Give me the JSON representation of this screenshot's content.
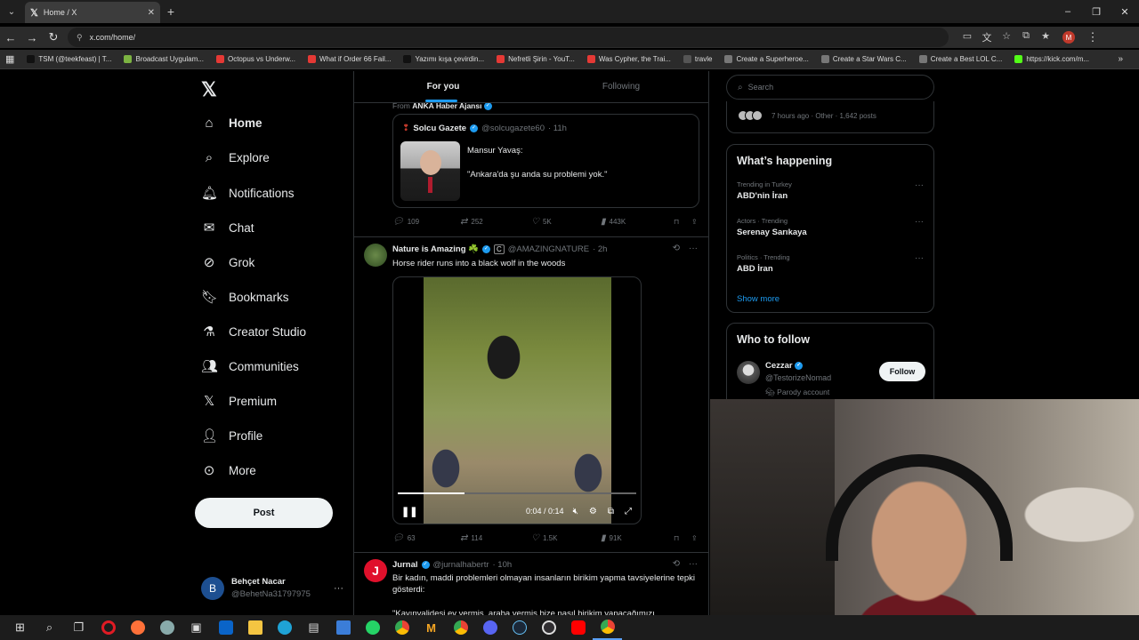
{
  "browser": {
    "tab_title": "Home / X",
    "url": "x.com/home/",
    "profile_initial": "M",
    "bookmarks": [
      {
        "label": "TSM (@teekfeast) | T...",
        "color": "#111111"
      },
      {
        "label": "Broadcast Uygulam...",
        "color": "#7cb342"
      },
      {
        "label": "Octopus vs Underw...",
        "color": "#e53935"
      },
      {
        "label": "What if Order 66 Fail...",
        "color": "#e53935"
      },
      {
        "label": "Yazımı kışa çevirdin...",
        "color": "#111111"
      },
      {
        "label": "Nefretli Şirin - YouT...",
        "color": "#e53935"
      },
      {
        "label": "Was Cypher, the Trai...",
        "color": "#e53935"
      },
      {
        "label": "travle",
        "color": "#555555"
      },
      {
        "label": "Create a Superheroe...",
        "color": "#777777"
      },
      {
        "label": "Create a Star Wars C...",
        "color": "#777777"
      },
      {
        "label": "Create a Best LOL C...",
        "color": "#777777"
      },
      {
        "label": "https://kick.com/m...",
        "color": "#53fc18"
      }
    ]
  },
  "nav": {
    "items": [
      {
        "label": "Home",
        "icon": "home-icon",
        "glyph": "⌂"
      },
      {
        "label": "Explore",
        "icon": "search-icon",
        "glyph": "⌕"
      },
      {
        "label": "Notifications",
        "icon": "bell-icon",
        "glyph": "🔔︎"
      },
      {
        "label": "Chat",
        "icon": "mail-icon",
        "glyph": "✉"
      },
      {
        "label": "Grok",
        "icon": "grok-icon",
        "glyph": "⊘"
      },
      {
        "label": "Bookmarks",
        "icon": "bookmark-icon",
        "glyph": "🔖︎"
      },
      {
        "label": "Creator Studio",
        "icon": "flask-icon",
        "glyph": "⚗"
      },
      {
        "label": "Communities",
        "icon": "people-icon",
        "glyph": "👥︎"
      },
      {
        "label": "Premium",
        "icon": "x-icon",
        "glyph": "𝕏"
      },
      {
        "label": "Profile",
        "icon": "person-icon",
        "glyph": "👤︎"
      },
      {
        "label": "More",
        "icon": "more-circle-icon",
        "glyph": "⊙"
      }
    ],
    "post_label": "Post",
    "account": {
      "initial": "B",
      "name": "Behçet Nacar",
      "handle": "@BehetNa31797975"
    }
  },
  "feed": {
    "tabs": [
      "For you",
      "Following"
    ],
    "from_prefix": "From",
    "from_name": "ANKA Haber Ajansı",
    "quote": {
      "name": "Solcu Gazete",
      "handle": "@solcugazete60",
      "time": "· 11h",
      "line1": "Mansur Yavaş:",
      "line2": "\"Ankara'da şu anda su problemi yok.\""
    },
    "quote_actions": {
      "replies": "109",
      "reposts": "252",
      "likes": "5K",
      "views": "443K"
    },
    "post2": {
      "name": "Nature is Amazing ☘️",
      "handle": "@AMAZINGNATURE",
      "time": "· 2h",
      "text": "Horse rider runs into a black wolf in the woods",
      "video_time": "0:04 / 0:14",
      "progress": 0.28,
      "actions": {
        "replies": "63",
        "reposts": "114",
        "likes": "1.5K",
        "views": "91K"
      }
    },
    "post3": {
      "name": "Jurnal",
      "handle": "@jurnalhabertr",
      "time": "· 10h",
      "text": "Bir kadın, maddi problemleri olmayan insanların birikim yapma tavsiyelerine tepki gösterdi:",
      "text2": "\"Kayınvalidesi ev vermiş, araba vermiş bize nasıl birikim yapacağımızı"
    }
  },
  "right": {
    "search_placeholder": "Search",
    "top_meta": "7 hours ago · Other · 1,642 posts",
    "whats_happening_title": "What’s happening",
    "trends": [
      {
        "context": "Trending in Turkey",
        "name": "ABD'nin İran"
      },
      {
        "context": "Actors · Trending",
        "name": "Serenay Sarıkaya"
      },
      {
        "context": "Politics · Trending",
        "name": "ABD İran"
      }
    ],
    "show_more": "Show more",
    "who_to_follow_title": "Who to follow",
    "suggestion": {
      "name": "Cezzar",
      "handle": "@TestorizeNomad",
      "label": "Parody account",
      "follow": "Follow"
    }
  }
}
